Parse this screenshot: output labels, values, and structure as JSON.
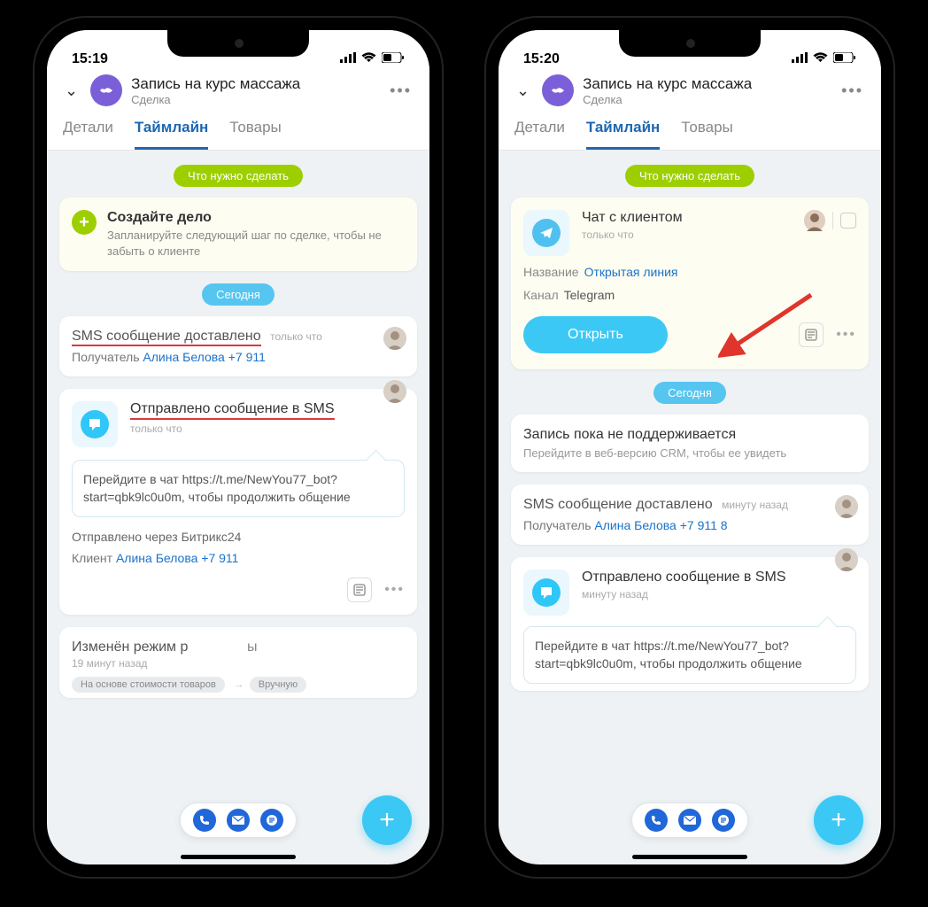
{
  "status": {
    "time_left": "15:19",
    "time_right": "15:20"
  },
  "header": {
    "title": "Запись на курс массажа",
    "subtitle": "Сделка"
  },
  "tabs": {
    "details": "Детали",
    "timeline": "Таймлайн",
    "goods": "Товары"
  },
  "pills": {
    "todo": "Что нужно сделать",
    "today": "Сегодня"
  },
  "create": {
    "title": "Создайте дело",
    "subtitle": "Запланируйте следующий шаг по сделке, чтобы не забыть о клиенте"
  },
  "left": {
    "sms_delivered": "SMS сообщение доставлено",
    "just_now": "только что",
    "recipient_label": "Получатель",
    "recipient_name": "Алина Белова +7 911",
    "sent_sms_title": "Отправлено сообщение в SMS",
    "bubble": "Перейдите в чат https://t.me/NewYou77_bot?start=qbk9lc0u0m, чтобы продолжить общение",
    "sent_via": "Отправлено через Битрикс24",
    "client_label": "Клиент",
    "client_name": "Алина Белова +7 911",
    "changed_mode": "Изменён режим р",
    "changed_mode_time": "19 минут назад",
    "pill_from": "На основе стоимости товаров",
    "pill_to": "Вручную"
  },
  "right": {
    "chat_title": "Чат с клиентом",
    "chat_sub": "только что",
    "name_label": "Название",
    "name_value": "Открытая линия",
    "channel_label": "Канал",
    "channel_value": "Telegram",
    "open_btn": "Открыть",
    "today": "Сегодня",
    "unsupported_title": "Запись пока не поддерживается",
    "unsupported_sub": "Перейдите в веб-версию CRM, чтобы ее увидеть",
    "sms_delivered": "SMS сообщение доставлено",
    "minute_ago": "минуту назад",
    "recipient_label": "Получатель",
    "recipient_name": "Алина Белова +7 911 8",
    "sent_sms_title": "Отправлено сообщение в SMS",
    "bubble": "Перейдите в чат https://t.me/NewYou77_bot?start=qbk9lc0u0m, чтобы продолжить общение"
  }
}
